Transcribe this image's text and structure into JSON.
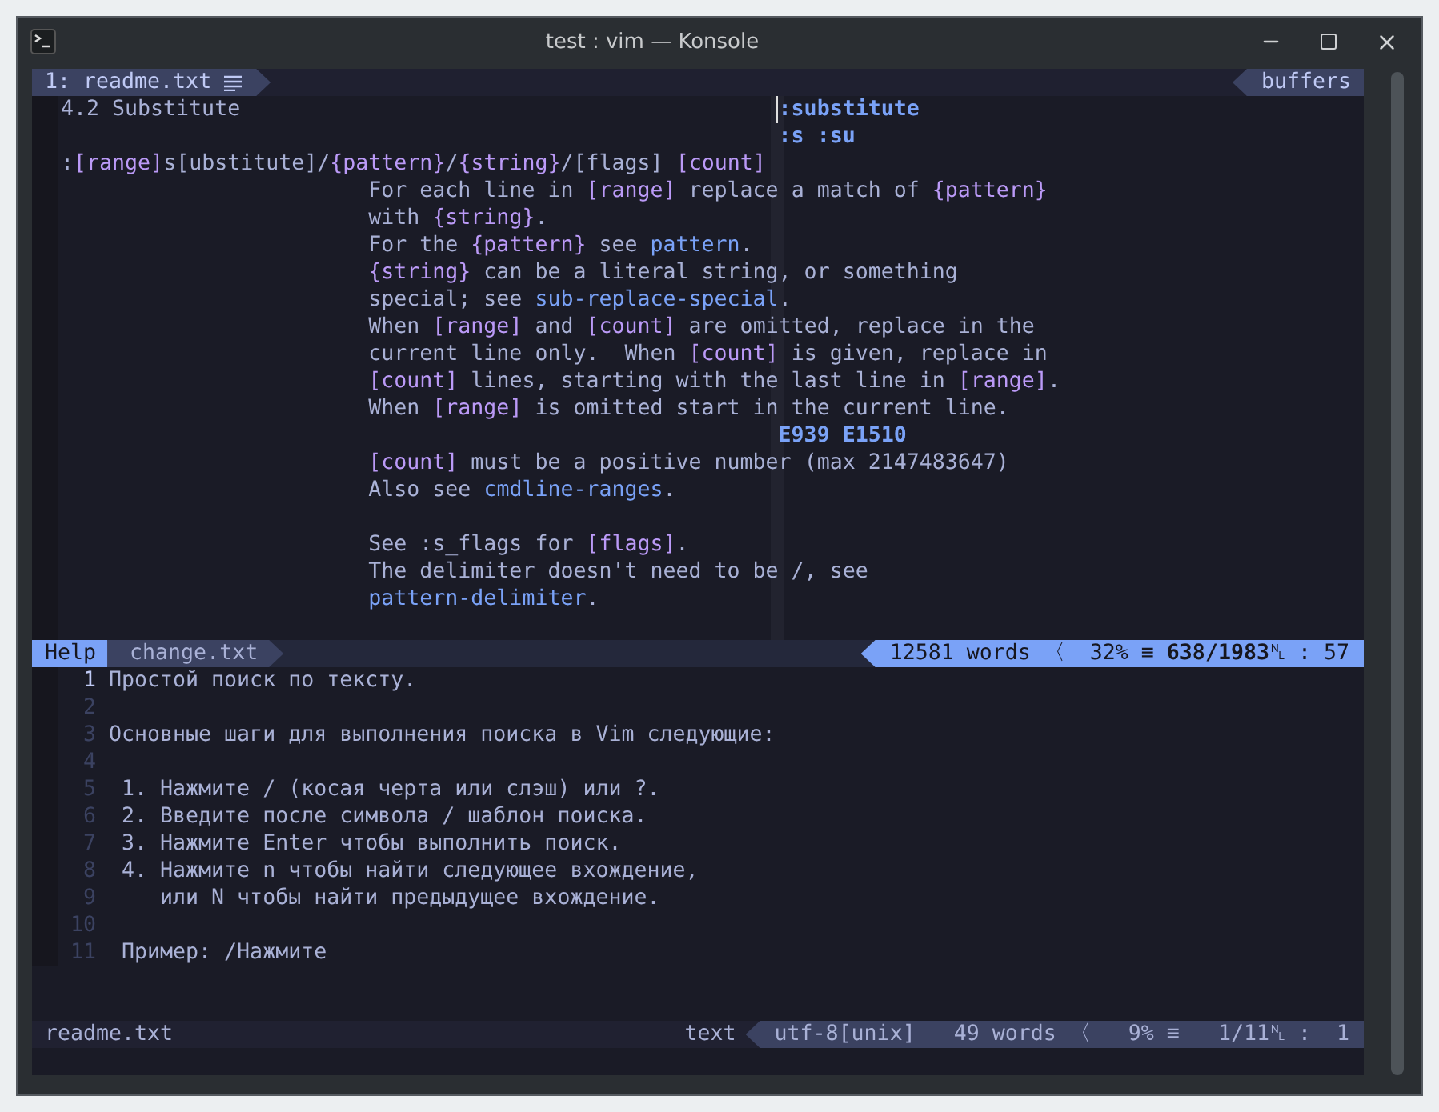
{
  "window": {
    "title": "test : vim — Konsole"
  },
  "tabline": {
    "tabs": [
      {
        "label": "1: readme.txt",
        "selected": true
      }
    ],
    "buffers_label": "buffers"
  },
  "help_pane": {
    "lines": [
      {
        "kind": "title",
        "segments": [
          {
            "kind": "plain",
            "text": "4.2 Substitute"
          }
        ],
        "tag": ":substitute"
      },
      {
        "kind": "tag",
        "segments": [
          {
            "kind": "tag",
            "text": ":s :su"
          }
        ]
      },
      {
        "kind": "syntax",
        "segments": [
          {
            "kind": "plain",
            "text": ":"
          },
          {
            "kind": "arg",
            "text": "[range]"
          },
          {
            "kind": "plain",
            "text": "s[ubstitute]/"
          },
          {
            "kind": "arg",
            "text": "{pattern}"
          },
          {
            "kind": "plain",
            "text": "/"
          },
          {
            "kind": "arg",
            "text": "{string}"
          },
          {
            "kind": "plain",
            "text": "/[flags] "
          },
          {
            "kind": "arg",
            "text": "[count]"
          }
        ]
      },
      {
        "kind": "body",
        "segments": [
          {
            "kind": "plain",
            "text": "For each line in "
          },
          {
            "kind": "arg",
            "text": "[range]"
          },
          {
            "kind": "plain",
            "text": " replace a match of "
          },
          {
            "kind": "arg",
            "text": "{pattern}"
          }
        ]
      },
      {
        "kind": "body",
        "segments": [
          {
            "kind": "plain",
            "text": "with "
          },
          {
            "kind": "arg",
            "text": "{string}"
          },
          {
            "kind": "plain",
            "text": "."
          }
        ]
      },
      {
        "kind": "body",
        "segments": [
          {
            "kind": "plain",
            "text": "For the "
          },
          {
            "kind": "arg",
            "text": "{pattern}"
          },
          {
            "kind": "plain",
            "text": " see "
          },
          {
            "kind": "link",
            "text": "pattern"
          },
          {
            "kind": "plain",
            "text": "."
          }
        ]
      },
      {
        "kind": "body",
        "segments": [
          {
            "kind": "arg",
            "text": "{string}"
          },
          {
            "kind": "plain",
            "text": " can be a literal string, or something"
          }
        ]
      },
      {
        "kind": "body",
        "segments": [
          {
            "kind": "plain",
            "text": "special; see "
          },
          {
            "kind": "link",
            "text": "sub-replace-special"
          },
          {
            "kind": "plain",
            "text": "."
          }
        ]
      },
      {
        "kind": "body",
        "segments": [
          {
            "kind": "plain",
            "text": "When "
          },
          {
            "kind": "arg",
            "text": "[range]"
          },
          {
            "kind": "plain",
            "text": " and "
          },
          {
            "kind": "arg",
            "text": "[count]"
          },
          {
            "kind": "plain",
            "text": " are omitted, replace in the"
          }
        ]
      },
      {
        "kind": "body",
        "segments": [
          {
            "kind": "plain",
            "text": "current line only.  When "
          },
          {
            "kind": "arg",
            "text": "[count]"
          },
          {
            "kind": "plain",
            "text": " is given, replace in"
          }
        ]
      },
      {
        "kind": "body",
        "segments": [
          {
            "kind": "arg",
            "text": "[count]"
          },
          {
            "kind": "plain",
            "text": " lines, starting with the last line in "
          },
          {
            "kind": "arg",
            "text": "[range]"
          },
          {
            "kind": "plain",
            "text": "."
          }
        ]
      },
      {
        "kind": "body",
        "segments": [
          {
            "kind": "plain",
            "text": "When "
          },
          {
            "kind": "arg",
            "text": "[range]"
          },
          {
            "kind": "plain",
            "text": " is omitted start in the current line."
          }
        ]
      },
      {
        "kind": "tag",
        "segments": [
          {
            "kind": "tag",
            "text": "E939 E1510"
          }
        ]
      },
      {
        "kind": "body",
        "segments": [
          {
            "kind": "arg",
            "text": "[count]"
          },
          {
            "kind": "plain",
            "text": " must be a positive number (max 2147483647)"
          }
        ]
      },
      {
        "kind": "body",
        "segments": [
          {
            "kind": "plain",
            "text": "Also see "
          },
          {
            "kind": "link",
            "text": "cmdline-ranges"
          },
          {
            "kind": "plain",
            "text": "."
          }
        ]
      },
      {
        "kind": "blank"
      },
      {
        "kind": "body",
        "segments": [
          {
            "kind": "plain",
            "text": "See :s_flags for "
          },
          {
            "kind": "arg",
            "text": "[flags]"
          },
          {
            "kind": "plain",
            "text": "."
          }
        ]
      },
      {
        "kind": "body",
        "segments": [
          {
            "kind": "plain",
            "text": "The delimiter doesn't need to be /, see"
          }
        ]
      },
      {
        "kind": "body",
        "segments": [
          {
            "kind": "link",
            "text": "pattern-delimiter"
          },
          {
            "kind": "plain",
            "text": "."
          }
        ]
      },
      {
        "kind": "blank"
      }
    ]
  },
  "help_status": {
    "mode": "Help",
    "file": "change.txt",
    "stats": "12581 words 〈  32% ≡ **638/1983**␤ : 57"
  },
  "editor_pane": {
    "lines": [
      {
        "number": "1",
        "text": "Простой поиск по тексту.",
        "current": true
      },
      {
        "number": "2",
        "current": false
      },
      {
        "number": "3",
        "text": "Основные шаги для выполнения поиска в Vim следующие:",
        "current": false
      },
      {
        "number": "4",
        "current": false
      },
      {
        "number": "5",
        "text": " 1. Нажмите / (косая черта или слэш) или ?.",
        "current": false
      },
      {
        "number": "6",
        "text": " 2. Введите после символа / шаблон поиска.",
        "current": false
      },
      {
        "number": "7",
        "text": " 3. Нажмите Enter чтобы выполнить поиск.",
        "current": false
      },
      {
        "number": "8",
        "text": " 4. Нажмите n чтобы найти следующее вхождение,",
        "current": false
      },
      {
        "number": "9",
        "text": "    или N чтобы найти предыдущее вхождение.",
        "current": false
      },
      {
        "number": "10",
        "current": false
      },
      {
        "number": "11",
        "text": " Пример: /Нажмите",
        "current": false
      }
    ]
  },
  "editor_status": {
    "file": "readme.txt",
    "filetype": "text",
    "stats": "utf-8[unix]   49 words 〈   9% ≡   1/11␤ :  1"
  }
}
